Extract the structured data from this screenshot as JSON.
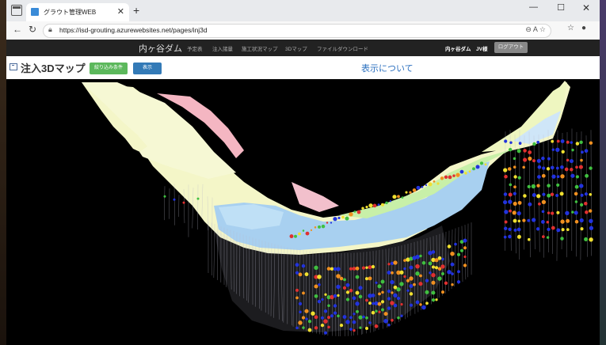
{
  "browser": {
    "tab_title": "グラウト管理WEB",
    "tab_close": "✕",
    "new_tab": "+",
    "url": "https://isd-grouting.azurewebsites.net/pages/inj3d",
    "window_controls": {
      "minimize": "—",
      "maximize": "☐",
      "close": "✕"
    },
    "nav_icons": {
      "back": "←",
      "reload": "↻"
    }
  },
  "navbar": {
    "brand": "内ヶ谷ダム",
    "links": [
      "予定表",
      "注入諸量",
      "施工状況マップ",
      "3Dマップ",
      "ファイルダウンロード"
    ],
    "user": "内ヶ谷ダム　JV様",
    "logout": "ログアウト"
  },
  "page": {
    "title": "注入3Dマップ",
    "filter_button": "絞り込み条件",
    "show_button": "表示",
    "about_link": "表示について"
  },
  "colors": {
    "terrain_yellow": "#f4f6c8",
    "terrain_pink": "#f4b6c2",
    "terrain_blue": "#a8d0f0",
    "terrain_green": "#c8f0a8",
    "point_blue": "#2233dd",
    "point_red": "#e03030",
    "point_yellow": "#f0e030",
    "point_green": "#40c040",
    "point_orange": "#f09020"
  }
}
